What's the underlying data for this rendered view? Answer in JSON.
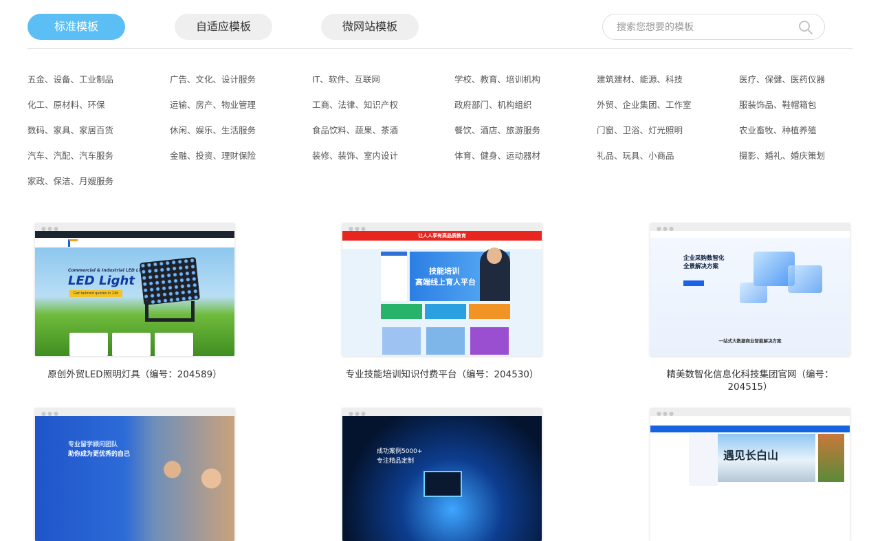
{
  "tabs": [
    {
      "label": "标准模板",
      "active": true
    },
    {
      "label": "自适应模板",
      "active": false
    },
    {
      "label": "微网站模板",
      "active": false
    }
  ],
  "search": {
    "placeholder": "搜索您想要的模板",
    "value": "",
    "icon": "search-icon"
  },
  "categories": [
    "五金、设备、工业制品",
    "广告、文化、设计服务",
    "IT、软件、互联网",
    "学校、教育、培训机构",
    "建筑建材、能源、科技",
    "医疗、保健、医药仪器",
    "化工、原材料、环保",
    "运输、房产、物业管理",
    "工商、法律、知识产权",
    "政府部门、机构组织",
    "外贸、企业集团、工作室",
    "服装饰品、鞋帽箱包",
    "数码、家具、家居百货",
    "休闲、娱乐、生活服务",
    "食品饮料、蔬果、茶酒",
    "餐饮、酒店、旅游服务",
    "门窗、卫浴、灯光照明",
    "农业畜牧、种植养殖",
    "汽车、汽配、汽车服务",
    "金融、投资、理财保险",
    "装修、装饰、室内设计",
    "体育、健身、运动器材",
    "礼品、玩具、小商品",
    "摄影、婚礼、婚庆策划",
    "家政、保洁、月嫂服务"
  ],
  "templates": [
    {
      "caption": "原创外贸LED照明灯具（编号：204589）",
      "thumb": {
        "hero_small": "Commercial & Industrial LED Lighting",
        "hero_big": "LED Light",
        "hero_btn": "Get tailored quotes in 24h"
      }
    },
    {
      "caption": "专业技能培训知识付费平台（编号：204530）",
      "thumb": {
        "top_banner": "让人人享有高品质教育",
        "b1": "技能培训",
        "b2": "高端线上育人平台"
      }
    },
    {
      "caption": "精美数智化信息化科技集团官网（编号：204515）",
      "thumb": {
        "h1": "企业采购数智化",
        "h2": "全景解决方案",
        "footer": "一站式大数据商业智能解决方案"
      }
    },
    {
      "caption": "",
      "thumb": {
        "l1": "专业留学顾问团队",
        "l2": "助你成为更优秀的自己"
      }
    },
    {
      "caption": "",
      "thumb": {
        "a": "成功案例5000+",
        "b": "专注精品定制"
      }
    },
    {
      "caption": "",
      "thumb": {
        "title": "遇见长白山"
      }
    }
  ],
  "colors": {
    "accent": "#5bbff6",
    "tab_bg": "#efefef"
  }
}
